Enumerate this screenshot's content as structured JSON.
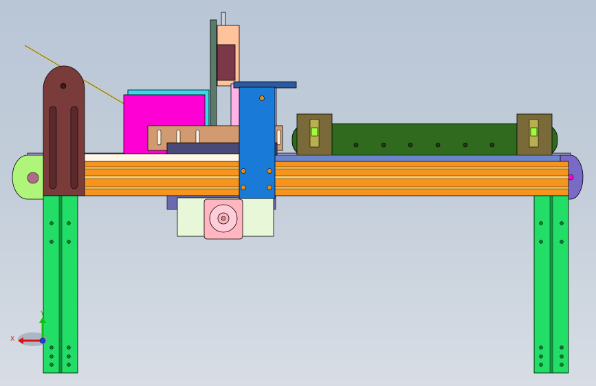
{
  "viewport": {
    "background_top": "#b9c6d6",
    "background_bottom": "#d8dde5"
  },
  "model": {
    "palette": {
      "rail": "#f7941d",
      "rail_stripe": "#ffb74d",
      "legs": "#22dd66",
      "carriage": "#1a7ad8",
      "belt": "#2f6a1f",
      "bracket": "#7a3b3b",
      "motor": "#ffb6c1",
      "magenta_block": "#ff00d4",
      "cyan_block": "#38d8e8",
      "tan_plate": "#d29a70",
      "end_cap": "#aef57a",
      "sensor": "#9dff3a",
      "base_plate": "#e9f7d9",
      "slide_tube": "#ffc39c",
      "cylinder": "#7a3848"
    }
  },
  "triad": {
    "x_label": "X",
    "y_label": "Y",
    "z_label": "Z",
    "x_icon": "x-axis-arrow-icon",
    "y_icon": "y-axis-arrow-icon",
    "z_icon": "z-axis-dot-icon"
  }
}
